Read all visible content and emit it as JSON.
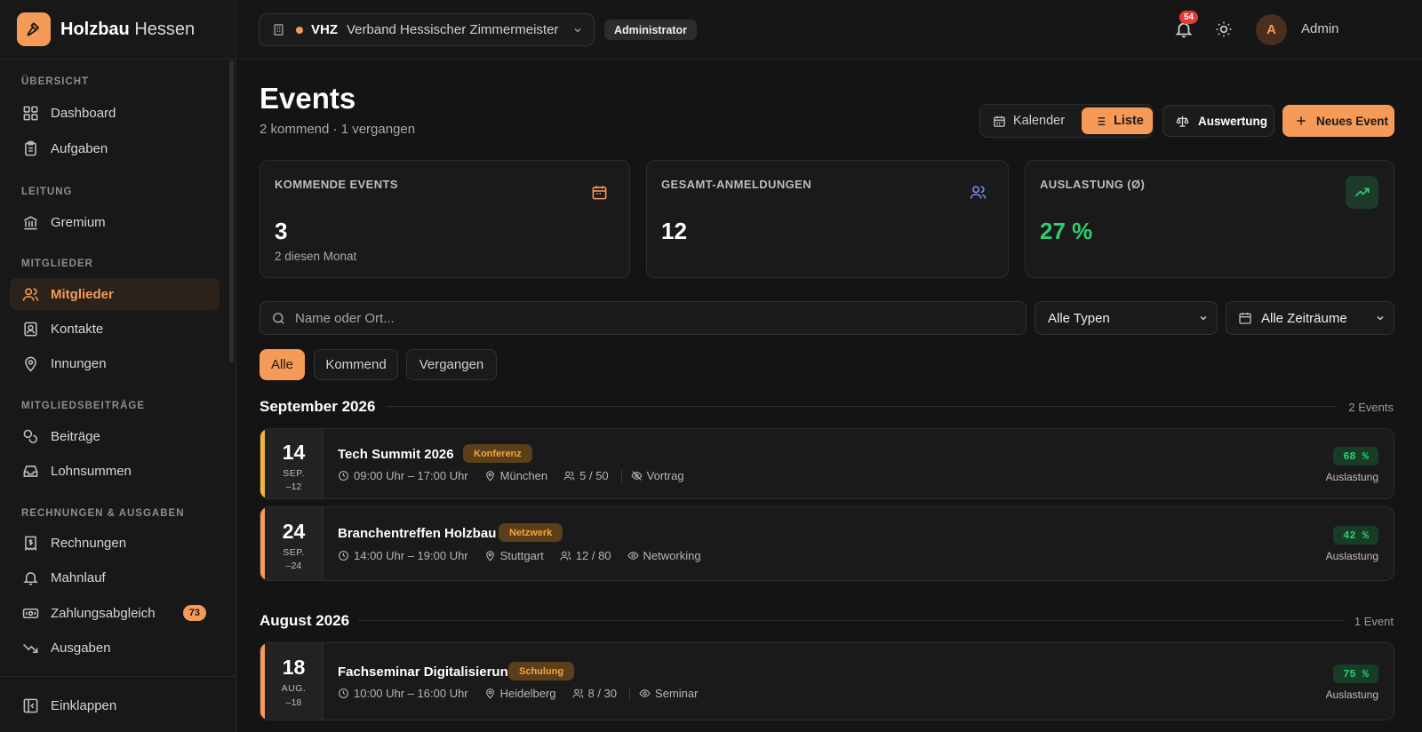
{
  "brand": {
    "name_bold": "Holzbau",
    "name_rest": "Hessen"
  },
  "sidebar": {
    "sections": [
      {
        "label": "ÜBERSICHT"
      },
      {
        "label": "LEITUNG"
      },
      {
        "label": "MITGLIEDER"
      },
      {
        "label": "MITGLIEDSBEITRÄGE"
      },
      {
        "label": "RECHNUNGEN & AUSGABEN"
      }
    ],
    "items": [
      {
        "label": "Dashboard",
        "icon": "grid-icon"
      },
      {
        "label": "Aufgaben",
        "icon": "clipboard-icon"
      },
      {
        "label": "Gremium",
        "icon": "building-columns-icon"
      },
      {
        "label": "Mitglieder",
        "icon": "users-icon",
        "active": true
      },
      {
        "label": "Kontakte",
        "icon": "contact-card-icon"
      },
      {
        "label": "Innungen",
        "icon": "map-pin-icon"
      },
      {
        "label": "Beiträge",
        "icon": "coins-icon"
      },
      {
        "label": "Lohnsummen",
        "icon": "inbox-icon"
      },
      {
        "label": "Rechnungen",
        "icon": "receipt-icon"
      },
      {
        "label": "Mahnlauf",
        "icon": "bell-icon"
      },
      {
        "label": "Zahlungsabgleich",
        "icon": "banknote-icon",
        "badge": "73"
      },
      {
        "label": "Ausgaben",
        "icon": "trending-down-icon"
      }
    ],
    "collapse_label": "Einklappen"
  },
  "topbar": {
    "org_abbr": "VHZ",
    "org_name": "Verband Hessischer Zimmermeister",
    "role": "Administrator",
    "notifications": "54",
    "avatar_initial": "A",
    "user_name": "Admin"
  },
  "page": {
    "title": "Events",
    "subtitle": "2 kommend · 1 vergangen",
    "view_calendar": "Kalender",
    "view_list": "Liste",
    "eval_label": "Auswertung",
    "new_label": "Neues Event"
  },
  "stats": [
    {
      "label": "KOMMENDE EVENTS",
      "value": "3",
      "note": "2 diesen Monat",
      "color": "#f59a57"
    },
    {
      "label": "GESAMT-ANMELDUNGEN",
      "value": "12",
      "note": "",
      "color": "#7c8cf5"
    },
    {
      "label": "AUSLASTUNG (Ø)",
      "value": "27 %",
      "note": "",
      "color": "#2ecc71"
    }
  ],
  "filters": {
    "search_placeholder": "Name oder Ort...",
    "type_select": "Alle Typen",
    "time_select": "Alle Zeiträume",
    "chips": [
      "Alle",
      "Kommend",
      "Vergangen"
    ]
  },
  "groups": [
    {
      "month": "September 2026",
      "count": "2 Events",
      "events": [
        {
          "day": "14",
          "mon": "SEP.",
          "sub": "–12",
          "title": "Tech Summit 2026",
          "tag": "Konferenz",
          "time": "09:00 Uhr – 17:00 Uhr",
          "place": "München",
          "seats": "5 / 50",
          "kind": "Vortrag",
          "pct": "68 %",
          "pct_label": "Auslastung",
          "bar": "#f5b33b"
        },
        {
          "day": "24",
          "mon": "SEP.",
          "sub": "–24",
          "title": "Branchentreffen Holzbau",
          "tag": "Netzwerk",
          "time": "14:00 Uhr – 19:00 Uhr",
          "place": "Stuttgart",
          "seats": "12 / 80",
          "kind": "Networking",
          "pct": "42 %",
          "pct_label": "Auslastung",
          "bar": "#f59a57"
        }
      ]
    },
    {
      "month": "August 2026",
      "count": "1 Event",
      "events": [
        {
          "day": "18",
          "mon": "AUG.",
          "sub": "–18",
          "title": "Fachseminar Digitalisierung",
          "tag": "Schulung",
          "time": "10:00 Uhr – 16:00 Uhr",
          "place": "Heidelberg",
          "seats": "8 / 30",
          "kind": "Seminar",
          "pct": "75 %",
          "pct_label": "Auslastung",
          "bar": "#f59a57"
        }
      ]
    }
  ]
}
